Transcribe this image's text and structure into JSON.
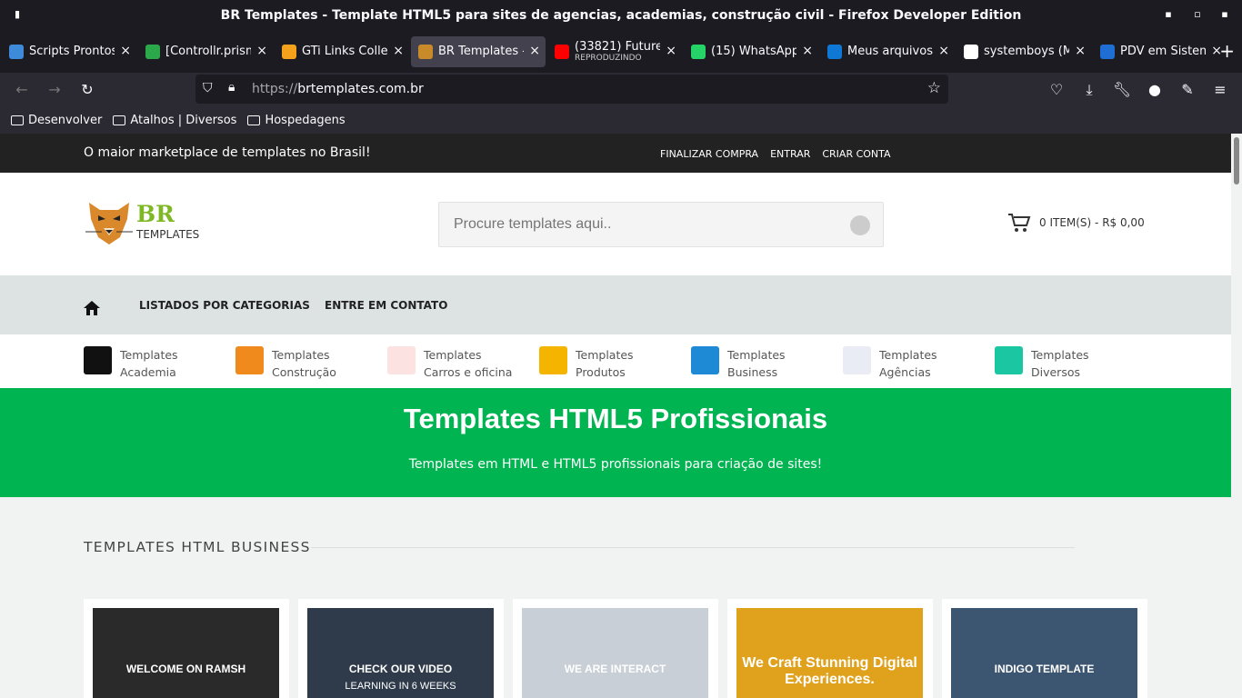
{
  "window": {
    "title": "BR Templates - Template HTML5 para sites de agencias, academias, construção civil - Firefox Developer Edition"
  },
  "tabs": [
    {
      "label": "Scripts Prontos",
      "icon": "cube-icon",
      "color": "#3d8bd9"
    },
    {
      "label": "[Controllr.prism",
      "icon": "gear-icon",
      "color": "#2aa84a"
    },
    {
      "label": "GTi Links Colle",
      "icon": "links-icon",
      "color": "#f4a21b"
    },
    {
      "label": "BR Templates -",
      "icon": "br-logo-icon",
      "color": "#c98a2a",
      "active": true
    },
    {
      "label": "(33821) Future",
      "sub": "REPRODUZINDO",
      "icon": "youtube-icon",
      "color": "#ff0000"
    },
    {
      "label": "(15) WhatsApp",
      "icon": "whatsapp-icon",
      "color": "#25d366"
    },
    {
      "label": "Meus arquivos",
      "icon": "cloud-icon",
      "color": "#0f78d4"
    },
    {
      "label": "systemboys (M",
      "icon": "github-icon",
      "color": "#ffffff"
    },
    {
      "label": "PDV em Sistem",
      "icon": "pdv-icon",
      "color": "#1f6ed4"
    }
  ],
  "navbar": {
    "url_prefix": "https://",
    "url_host": "brtemplates.com.br"
  },
  "bookmarks": [
    "Desenvolver",
    "Atalhos | Diversos",
    "Hospedagens"
  ],
  "site": {
    "tagline": "O maior marketplace de templates no Brasil!",
    "top_links": [
      "FINALIZAR COMPRA",
      "ENTRAR",
      "CRIAR CONTA"
    ],
    "logo": {
      "br": "BR",
      "templates": "TEMPLATES"
    },
    "search_placeholder": "Procure templates aqui..",
    "cart": "0 ITEM(S) - R$ 0,00",
    "nav": [
      "LISTADOS POR CATEGORIAS",
      "ENTRE EM CONTATO"
    ],
    "categories": [
      {
        "line1": "Templates",
        "line2": "Academia",
        "icon": "dumbbell-icon",
        "color": "#111111"
      },
      {
        "line1": "Templates",
        "line2": "Construção",
        "icon": "helmet-icon",
        "color": "#f08a1c"
      },
      {
        "line1": "Templates",
        "line2": "Carros e oficina",
        "icon": "car-icon",
        "color": "#fde2e2"
      },
      {
        "line1": "Templates",
        "line2": "Produtos",
        "icon": "cart-icon",
        "color": "#f5b400"
      },
      {
        "line1": "Templates",
        "line2": "Business",
        "icon": "briefcase-icon",
        "color": "#1e8ad6"
      },
      {
        "line1": "Templates",
        "line2": "Agências",
        "icon": "megaphone-icon",
        "color": "#e9ecf5"
      },
      {
        "line1": "Templates",
        "line2": "Diversos",
        "icon": "plus-icon",
        "color": "#1bc6a2"
      }
    ],
    "hero": {
      "title": "Templates HTML5 Profissionais",
      "subtitle": "Templates em HTML  e HTML5 profissionais para criação de sites!"
    },
    "section_title": "TEMPLATES HTML BUSINESS",
    "cards": [
      {
        "text": "WELCOME ON RAMSH",
        "bg": "#2a2a2a"
      },
      {
        "text": "CHECK OUR VIDEO",
        "sub": "LEARNING IN 6 WEEKS",
        "bg": "#2f3b4a"
      },
      {
        "text": "WE ARE INTERACT",
        "bg": "#c9cfd6"
      },
      {
        "text": "We Craft Stunning Digital Experiences.",
        "bg": "#e0a21d"
      },
      {
        "text": "INDIGO TEMPLATE",
        "bg": "#3c5571"
      }
    ]
  }
}
